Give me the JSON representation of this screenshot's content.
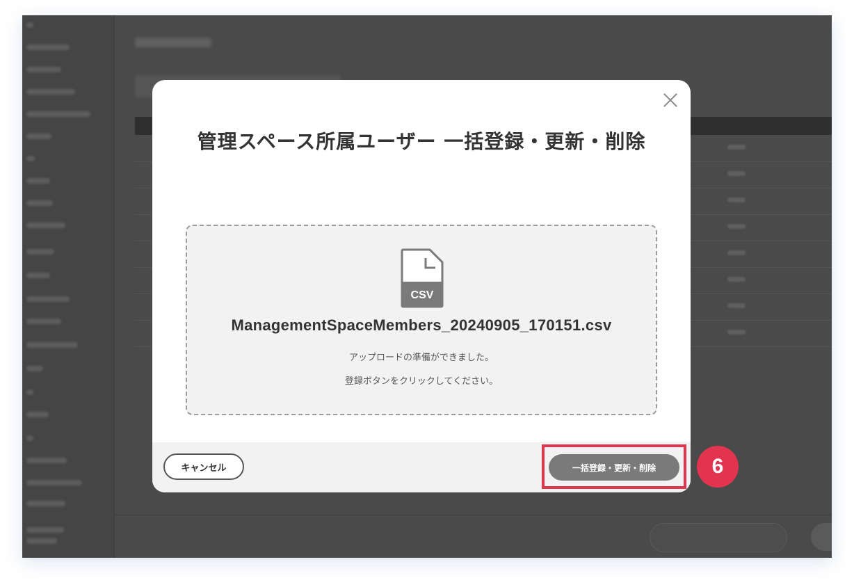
{
  "modal": {
    "title": "管理スペース所属ユーザー 一括登録・更新・削除",
    "file": {
      "type_label": "CSV",
      "name": "ManagementSpaceMembers_20240905_170151.csv"
    },
    "messages": [
      "アップロードの準備ができました。",
      "登録ボタンをクリックしてください。"
    ],
    "cancel_label": "キャンセル",
    "submit_label": "一括登録・更新・削除"
  },
  "annotation": {
    "step_number": "6",
    "color": "#e2344e"
  }
}
